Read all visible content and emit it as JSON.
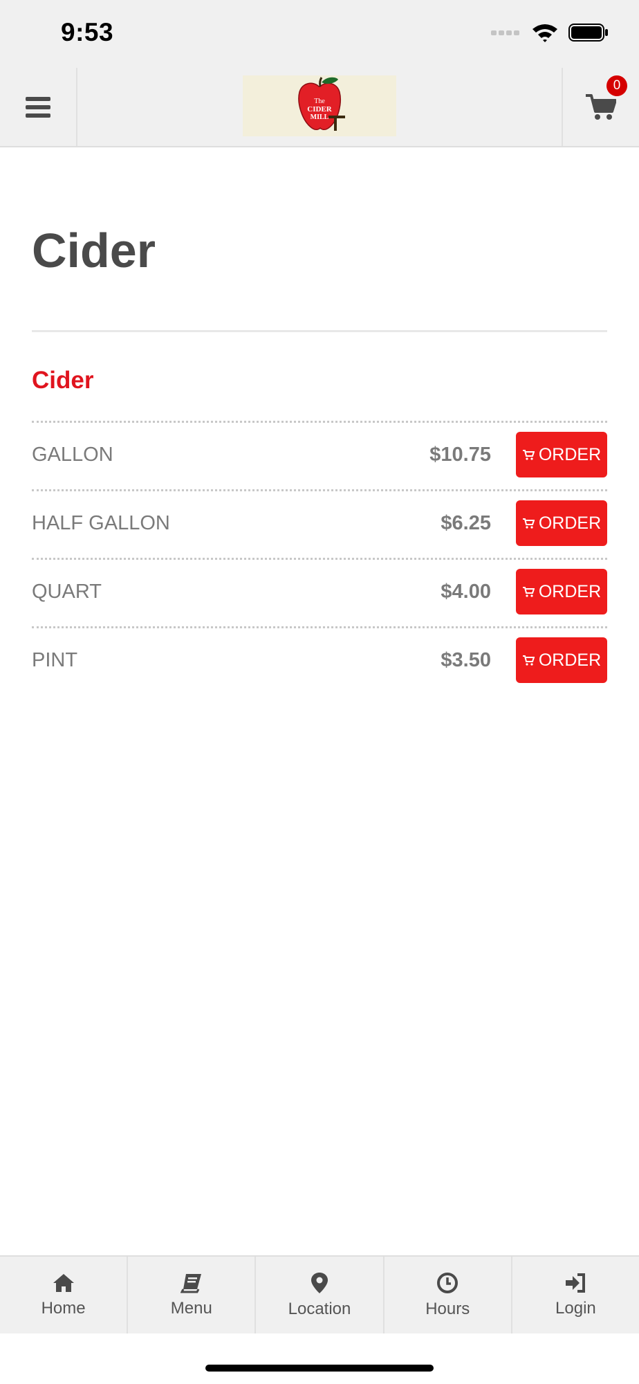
{
  "status_bar": {
    "time": "9:53"
  },
  "header": {
    "logo_text_line1": "The",
    "logo_text_line2": "CIDER",
    "logo_text_line3": "MILL",
    "cart_count": "0"
  },
  "page": {
    "title": "Cider",
    "section_title": "Cider"
  },
  "items": [
    {
      "name": "GALLON",
      "price": "$10.75",
      "button": "ORDER"
    },
    {
      "name": "HALF GALLON",
      "price": "$6.25",
      "button": "ORDER"
    },
    {
      "name": "QUART",
      "price": "$4.00",
      "button": "ORDER"
    },
    {
      "name": "PINT",
      "price": "$3.50",
      "button": "ORDER"
    }
  ],
  "tabs": [
    {
      "label": "Home",
      "icon": "home-icon"
    },
    {
      "label": "Menu",
      "icon": "book-icon"
    },
    {
      "label": "Location",
      "icon": "location-pin-icon"
    },
    {
      "label": "Hours",
      "icon": "clock-icon"
    },
    {
      "label": "Login",
      "icon": "login-icon"
    }
  ],
  "colors": {
    "accent": "#ee1c1c",
    "section_title": "#e0141e",
    "badge": "#d50000",
    "bar_bg": "#f0f0f0",
    "logo_bg": "#f3efdb"
  }
}
